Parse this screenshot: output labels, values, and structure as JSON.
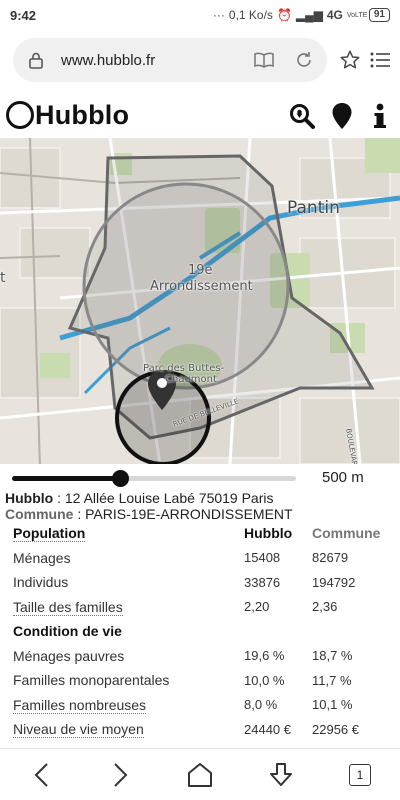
{
  "status_bar": {
    "time": "9:42",
    "dots": "···",
    "network_speed": "0,1 Ko/s",
    "network_type": "4G",
    "volte": "VoLTE",
    "battery": "91"
  },
  "browser": {
    "url": "www.hubblo.fr",
    "icons": [
      "lock-icon",
      "reader-mode-icon",
      "reload-icon",
      "bookmark-star-icon",
      "menu-icon"
    ]
  },
  "app": {
    "logo_text": "Hubblo",
    "header_icons": [
      "search-location-icon",
      "map-pin-icon",
      "info-icon"
    ]
  },
  "map": {
    "labels": {
      "pantin": "Pantin",
      "arrondissement_line1": "19e",
      "arrondissement_line2": "Arrondissement",
      "park_line1": "Parc des Buttes-",
      "park_line2": "Chaumont",
      "street": "RUE DE BELLEVILLE",
      "boulevard": "BOULEVARD",
      "edge_letter": "t"
    },
    "colors": {
      "land": "#e8e4dd",
      "park": "#c8dcb0",
      "water": "#3d9fd6",
      "boundary": "#666666",
      "circle": "#111111"
    }
  },
  "slider": {
    "value_label": "500 m",
    "position": 0.38
  },
  "info": {
    "hubblo_key": "Hubblo",
    "address": " : 12 Allée Louise Labé 75019 Paris",
    "commune_key": "Commune",
    "commune_value": " : PARIS-19E-ARRONDISSEMENT"
  },
  "stats": {
    "headers": {
      "label": "Population",
      "hubblo": "Hubblo",
      "commune": "Commune"
    },
    "rows": [
      {
        "label": "Ménages",
        "hubblo": "15408",
        "commune": "82679"
      },
      {
        "label": "Individus",
        "hubblo": "33876",
        "commune": "194792"
      },
      {
        "label": "Taille des familles",
        "hubblo": "2,20",
        "commune": "2,36"
      }
    ],
    "section2_title": "Condition de vie",
    "rows2": [
      {
        "label": "Ménages pauvres",
        "hubblo": "19,6 %",
        "commune": "18,7 %"
      },
      {
        "label": "Familles monoparentales",
        "hubblo": "10,0 %",
        "commune": "11,7 %"
      },
      {
        "label": "Familles nombreuses",
        "hubblo": "8,0 %",
        "commune": "10,1 %"
      },
      {
        "label": "Niveau de vie moyen",
        "hubblo": "24440 €",
        "commune": "22956 €"
      }
    ]
  },
  "bottom_nav": {
    "tabs_count": "1"
  }
}
